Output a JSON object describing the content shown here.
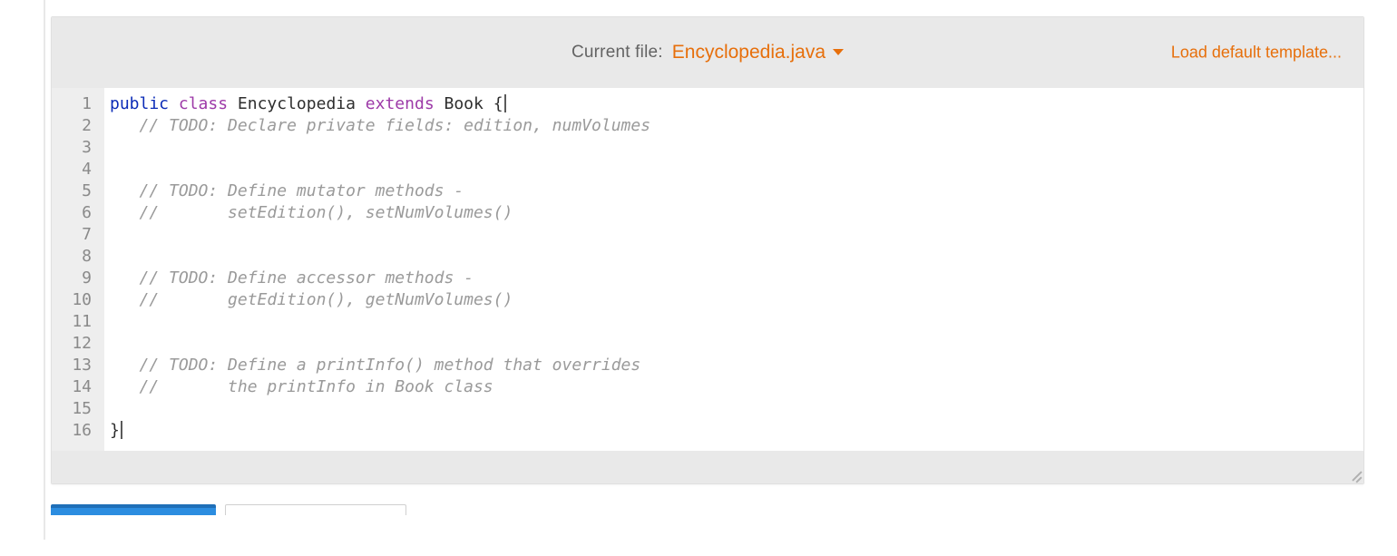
{
  "header": {
    "current_file_label": "Current file:",
    "current_file_name": "Encyclopedia.java",
    "load_template_label": "Load default template..."
  },
  "code": {
    "lines": [
      {
        "n": 1,
        "tokens": [
          {
            "c": "kw",
            "t": "public"
          },
          {
            "c": "sp",
            "t": " "
          },
          {
            "c": "kw2",
            "t": "class"
          },
          {
            "c": "sp",
            "t": " "
          },
          {
            "c": "id",
            "t": "Encyclopedia"
          },
          {
            "c": "sp",
            "t": " "
          },
          {
            "c": "kw2",
            "t": "extends"
          },
          {
            "c": "sp",
            "t": " "
          },
          {
            "c": "id",
            "t": "Book"
          },
          {
            "c": "sp",
            "t": " "
          },
          {
            "c": "pn",
            "t": "{"
          },
          {
            "c": "cursor",
            "t": ""
          }
        ]
      },
      {
        "n": 2,
        "tokens": [
          {
            "c": "sp",
            "t": "   "
          },
          {
            "c": "cm",
            "t": "// TODO: Declare private fields: edition, numVolumes"
          }
        ]
      },
      {
        "n": 3,
        "tokens": []
      },
      {
        "n": 4,
        "tokens": []
      },
      {
        "n": 5,
        "tokens": [
          {
            "c": "sp",
            "t": "   "
          },
          {
            "c": "cm",
            "t": "// TODO: Define mutator methods - "
          }
        ]
      },
      {
        "n": 6,
        "tokens": [
          {
            "c": "sp",
            "t": "   "
          },
          {
            "c": "cm",
            "t": "//       setEdition(), setNumVolumes()"
          }
        ]
      },
      {
        "n": 7,
        "tokens": []
      },
      {
        "n": 8,
        "tokens": []
      },
      {
        "n": 9,
        "tokens": [
          {
            "c": "sp",
            "t": "   "
          },
          {
            "c": "cm",
            "t": "// TODO: Define accessor methods -"
          }
        ]
      },
      {
        "n": 10,
        "tokens": [
          {
            "c": "sp",
            "t": "   "
          },
          {
            "c": "cm",
            "t": "//       getEdition(), getNumVolumes()"
          }
        ]
      },
      {
        "n": 11,
        "tokens": []
      },
      {
        "n": 12,
        "tokens": []
      },
      {
        "n": 13,
        "tokens": [
          {
            "c": "sp",
            "t": "   "
          },
          {
            "c": "cm",
            "t": "// TODO: Define a printInfo() method that overrides"
          }
        ]
      },
      {
        "n": 14,
        "tokens": [
          {
            "c": "sp",
            "t": "   "
          },
          {
            "c": "cm",
            "t": "//       the printInfo in Book class"
          }
        ]
      },
      {
        "n": 15,
        "tokens": []
      },
      {
        "n": 16,
        "tokens": [
          {
            "c": "pn",
            "t": "}"
          },
          {
            "c": "cursor",
            "t": ""
          }
        ]
      }
    ]
  }
}
